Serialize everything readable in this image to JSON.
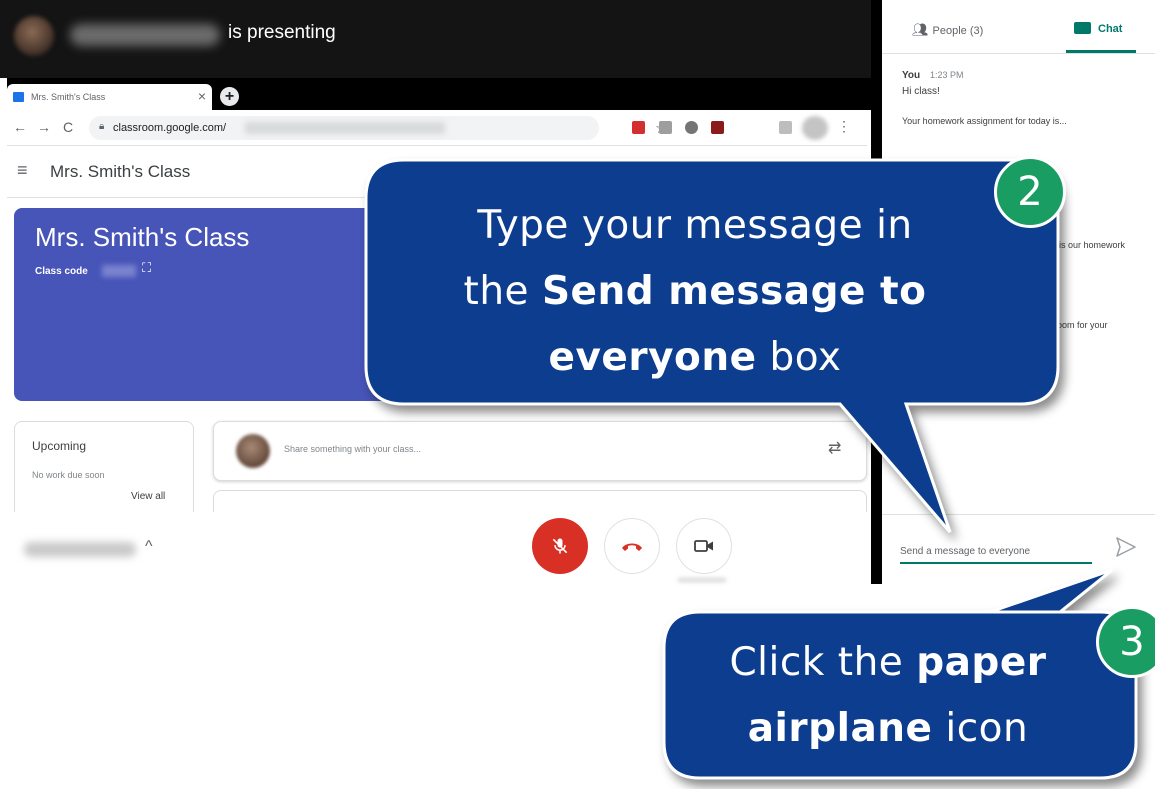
{
  "presenter": {
    "status": "is presenting"
  },
  "browser": {
    "tab_title": "Mrs. Smith's Class",
    "tab_close": "×",
    "new_tab": "+",
    "back": "←",
    "forward": "→",
    "reload": "C",
    "url": "classroom.google.com/",
    "star": "☆",
    "menu": "⋮"
  },
  "classroom": {
    "menu_icon": "≡",
    "nav_title": "Mrs. Smith's Class",
    "banner_title": "Mrs. Smith's Class",
    "class_code_label": "Class code",
    "fullscreen_icon": "⛶",
    "upcoming_title": "Upcoming",
    "upcoming_empty": "No work due soon",
    "view_all": "View all",
    "share_placeholder": "Share something with your class...",
    "repost_icon": "⇄"
  },
  "meet": {
    "details_chevron": "^"
  },
  "chat_panel": {
    "people_tab": "People (3)",
    "chat_tab": "Chat",
    "sender": "You",
    "time": "1:23 PM",
    "messages": [
      "Hi class!",
      "Your homework assignment for today is...",
      "t is our homework",
      "room for your"
    ],
    "input_placeholder": "Send a message to everyone"
  },
  "callouts": {
    "step2": {
      "badge": "2",
      "line1": "Type your message in",
      "line2_prefix": "the ",
      "line2_bold": "Send message to",
      "line3_bold": "everyone",
      "line3_suffix": " box"
    },
    "step3": {
      "badge": "3",
      "line1_prefix": "Click the ",
      "line1_bold": "paper",
      "line2_bold": "airplane",
      "line2_suffix": " icon"
    }
  },
  "colors": {
    "callout_blue": "#0d3c8e",
    "badge_green": "#1a9d62",
    "banner": "#4754b8",
    "chat_accent": "#00796b",
    "mic_red": "#d93025"
  },
  "icons": [
    "people-icon",
    "chat-icon",
    "send-icon",
    "mic-off-icon",
    "hangup-icon",
    "camera-icon",
    "star-icon",
    "lock-icon",
    "repost-icon"
  ]
}
